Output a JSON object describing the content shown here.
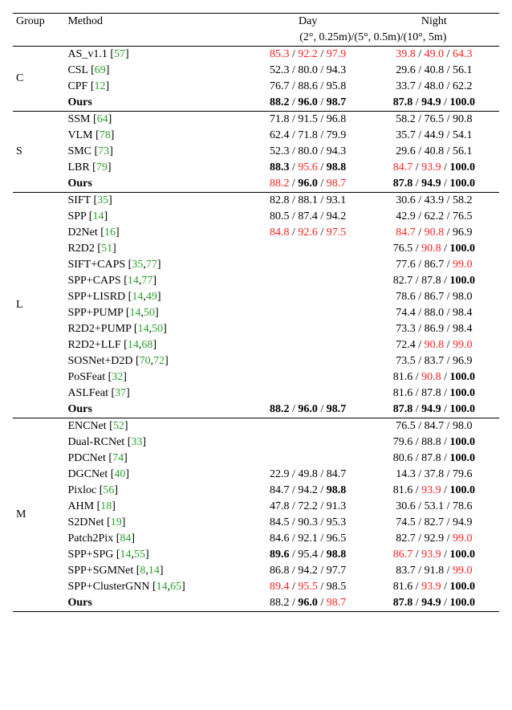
{
  "header": {
    "group": "Group",
    "method": "Method",
    "day": "Day",
    "night": "Night",
    "thresholds": "(2°, 0.25m)/(5°, 0.5m)/(10°, 5m)"
  },
  "chart_data": {
    "type": "table",
    "title": "",
    "columns": [
      "Group",
      "Method",
      "Day",
      "Night"
    ],
    "threshold_label": "(2°, 0.25m)/(5°, 0.5m)/(10°, 5m)"
  },
  "groups": [
    {
      "label": "C",
      "rows": [
        {
          "method": "AS_v1.1",
          "cites": [
            "57"
          ],
          "bold_method": false,
          "day": [
            {
              "v": "85.3",
              "red": true
            },
            {
              "v": "92.2",
              "red": true
            },
            {
              "v": "97.9",
              "red": true
            }
          ],
          "night": [
            {
              "v": "39.8",
              "red": true
            },
            {
              "v": "49.0",
              "red": true
            },
            {
              "v": "64.3",
              "red": true
            }
          ]
        },
        {
          "method": "CSL",
          "cites": [
            "69"
          ],
          "bold_method": false,
          "day": [
            {
              "v": "52.3"
            },
            {
              "v": "80.0"
            },
            {
              "v": "94.3"
            }
          ],
          "night": [
            {
              "v": "29.6"
            },
            {
              "v": "40.8"
            },
            {
              "v": "56.1"
            }
          ]
        },
        {
          "method": "CPF",
          "cites": [
            "12"
          ],
          "bold_method": false,
          "day": [
            {
              "v": "76.7"
            },
            {
              "v": "88.6"
            },
            {
              "v": "95.8"
            }
          ],
          "night": [
            {
              "v": "33.7"
            },
            {
              "v": "48.0"
            },
            {
              "v": "62.2"
            }
          ]
        },
        {
          "method": "Ours",
          "cites": [],
          "bold_method": true,
          "day": [
            {
              "v": "88.2",
              "bold": true
            },
            {
              "v": "96.0",
              "bold": true
            },
            {
              "v": "98.7",
              "bold": true
            }
          ],
          "night": [
            {
              "v": "87.8",
              "bold": true
            },
            {
              "v": "94.9",
              "bold": true
            },
            {
              "v": "100.0",
              "bold": true
            }
          ]
        }
      ]
    },
    {
      "label": "S",
      "rows": [
        {
          "method": "SSM",
          "cites": [
            "64"
          ],
          "day": [
            {
              "v": "71.8"
            },
            {
              "v": "91.5"
            },
            {
              "v": "96.8"
            }
          ],
          "night": [
            {
              "v": "58.2"
            },
            {
              "v": "76.5"
            },
            {
              "v": "90.8"
            }
          ]
        },
        {
          "method": "VLM",
          "cites": [
            "78"
          ],
          "day": [
            {
              "v": "62.4"
            },
            {
              "v": "71.8"
            },
            {
              "v": "79.9"
            }
          ],
          "night": [
            {
              "v": "35.7"
            },
            {
              "v": "44.9"
            },
            {
              "v": "54.1"
            }
          ]
        },
        {
          "method": "SMC",
          "cites": [
            "73"
          ],
          "day": [
            {
              "v": "52.3"
            },
            {
              "v": "80.0"
            },
            {
              "v": "94.3"
            }
          ],
          "night": [
            {
              "v": "29.6"
            },
            {
              "v": "40.8"
            },
            {
              "v": "56.1"
            }
          ]
        },
        {
          "method": "LBR",
          "cites": [
            "79"
          ],
          "day": [
            {
              "v": "88.3",
              "bold": true
            },
            {
              "v": "95.6",
              "red": true
            },
            {
              "v": "98.8",
              "bold": true
            }
          ],
          "night": [
            {
              "v": "84.7",
              "red": true
            },
            {
              "v": "93.9",
              "red": true
            },
            {
              "v": "100.0",
              "bold": true
            }
          ]
        },
        {
          "method": "Ours",
          "cites": [],
          "bold_method": true,
          "day": [
            {
              "v": "88.2",
              "red": true
            },
            {
              "v": "96.0",
              "bold": true
            },
            {
              "v": "98.7",
              "red": true
            }
          ],
          "night": [
            {
              "v": "87.8",
              "bold": true
            },
            {
              "v": "94.9",
              "bold": true
            },
            {
              "v": "100.0",
              "bold": true
            }
          ]
        }
      ]
    },
    {
      "label": "L",
      "rows": [
        {
          "method": "SIFT ",
          "cites": [
            "35"
          ],
          "day": [
            {
              "v": "82.8"
            },
            {
              "v": "88.1"
            },
            {
              "v": "93.1"
            }
          ],
          "night": [
            {
              "v": "30.6"
            },
            {
              "v": "43.9"
            },
            {
              "v": "58.2"
            }
          ]
        },
        {
          "method": "SPP",
          "cites": [
            "14"
          ],
          "day": [
            {
              "v": "80.5"
            },
            {
              "v": "87.4"
            },
            {
              "v": "94.2"
            }
          ],
          "night": [
            {
              "v": "42.9"
            },
            {
              "v": "62.2"
            },
            {
              "v": "76.5"
            }
          ]
        },
        {
          "method": "D2Net",
          "cites": [
            "16"
          ],
          "day": [
            {
              "v": "84.8",
              "red": true
            },
            {
              "v": "92.6",
              "red": true
            },
            {
              "v": "97.5",
              "red": true
            }
          ],
          "night": [
            {
              "v": "84.7",
              "red": true
            },
            {
              "v": "90.8",
              "red": true
            },
            {
              "v": "96.9"
            }
          ]
        },
        {
          "method": "R2D2",
          "cites": [
            "51"
          ],
          "day": [],
          "night": [
            {
              "v": "76.5"
            },
            {
              "v": "90.8",
              "red": true
            },
            {
              "v": "100.0",
              "bold": true
            }
          ]
        },
        {
          "method": "SIFT+CAPS",
          "cites": [
            "35",
            "77"
          ],
          "day": [],
          "night": [
            {
              "v": "77.6"
            },
            {
              "v": "86.7"
            },
            {
              "v": "99.0",
              "red": true
            }
          ]
        },
        {
          "method": "SPP+CAPS",
          "cites": [
            "14",
            "77"
          ],
          "day": [],
          "night": [
            {
              "v": "82.7"
            },
            {
              "v": "87.8"
            },
            {
              "v": "100.0",
              "bold": true
            }
          ]
        },
        {
          "method": "SPP+LISRD",
          "cites": [
            "14",
            "49"
          ],
          "day": [],
          "night": [
            {
              "v": "78.6"
            },
            {
              "v": "86.7"
            },
            {
              "v": "98.0"
            }
          ]
        },
        {
          "method": "SPP+PUMP",
          "cites": [
            "14",
            "50"
          ],
          "day": [],
          "night": [
            {
              "v": "74.4"
            },
            {
              "v": "88.0"
            },
            {
              "v": "98.4"
            }
          ]
        },
        {
          "method": "R2D2+PUMP",
          "cites": [
            "14",
            "50"
          ],
          "day": [],
          "night": [
            {
              "v": "73.3"
            },
            {
              "v": "86.9"
            },
            {
              "v": "98.4"
            }
          ]
        },
        {
          "method": "R2D2+LLF",
          "cites": [
            "14",
            "68"
          ],
          "day": [],
          "night": [
            {
              "v": "72.4"
            },
            {
              "v": "90.8",
              "red": true
            },
            {
              "v": "99.0",
              "red": true
            }
          ]
        },
        {
          "method": "SOSNet+D2D",
          "cites": [
            "70",
            "72"
          ],
          "day": [],
          "night": [
            {
              "v": "73.5"
            },
            {
              "v": "83.7"
            },
            {
              "v": "96.9"
            }
          ]
        },
        {
          "method": "PoSFeat",
          "cites": [
            "32"
          ],
          "day": [],
          "night": [
            {
              "v": "81.6"
            },
            {
              "v": "90.8",
              "red": true
            },
            {
              "v": "100.0",
              "bold": true
            }
          ]
        },
        {
          "method": "ASLFeat",
          "cites": [
            "37"
          ],
          "day": [],
          "night": [
            {
              "v": "81.6"
            },
            {
              "v": "87.8"
            },
            {
              "v": "100.0",
              "bold": true
            }
          ]
        },
        {
          "method": "Ours",
          "cites": [],
          "bold_method": true,
          "day": [
            {
              "v": "88.2",
              "bold": true
            },
            {
              "v": "96.0",
              "bold": true
            },
            {
              "v": "98.7",
              "bold": true
            }
          ],
          "night": [
            {
              "v": "87.8",
              "bold": true
            },
            {
              "v": "94.9",
              "bold": true
            },
            {
              "v": "100.0",
              "bold": true
            }
          ]
        }
      ]
    },
    {
      "label": "M",
      "rows": [
        {
          "method": "ENCNet",
          "cites": [
            "52"
          ],
          "day": [],
          "night": [
            {
              "v": "76.5"
            },
            {
              "v": "84.7"
            },
            {
              "v": "98.0"
            }
          ]
        },
        {
          "method": "Dual-RCNet",
          "cites": [
            "33"
          ],
          "day": [],
          "night": [
            {
              "v": "79.6"
            },
            {
              "v": "88.8"
            },
            {
              "v": "100.0",
              "bold": true
            }
          ]
        },
        {
          "method": "PDCNet",
          "cites": [
            "74"
          ],
          "day": [],
          "night": [
            {
              "v": "80.6"
            },
            {
              "v": "87.8"
            },
            {
              "v": "100.0",
              "bold": true
            }
          ]
        },
        {
          "method": "DGCNet",
          "cites": [
            "40"
          ],
          "day": [
            {
              "v": "22.9"
            },
            {
              "v": "49.8"
            },
            {
              "v": "84.7"
            }
          ],
          "night": [
            {
              "v": "14.3"
            },
            {
              "v": "37.8"
            },
            {
              "v": "79.6"
            }
          ]
        },
        {
          "method": "Pixloc",
          "cites": [
            "56"
          ],
          "day": [
            {
              "v": "84.7"
            },
            {
              "v": "94.2"
            },
            {
              "v": "98.8",
              "bold": true
            }
          ],
          "night": [
            {
              "v": "81.6"
            },
            {
              "v": "93.9",
              "red": true
            },
            {
              "v": "100.0",
              "bold": true
            }
          ]
        },
        {
          "method": "AHM",
          "cites": [
            "18"
          ],
          "day": [
            {
              "v": "47.8"
            },
            {
              "v": "72.2"
            },
            {
              "v": "91.3"
            }
          ],
          "night": [
            {
              "v": "30.6"
            },
            {
              "v": "53.1"
            },
            {
              "v": "78.6"
            }
          ]
        },
        {
          "method": "S2DNet",
          "cites": [
            "19"
          ],
          "day": [
            {
              "v": "84.5"
            },
            {
              "v": "90.3"
            },
            {
              "v": "95.3"
            }
          ],
          "night": [
            {
              "v": "74.5"
            },
            {
              "v": "82.7"
            },
            {
              "v": "94.9"
            }
          ]
        },
        {
          "method": "Patch2Pix",
          "cites": [
            "84"
          ],
          "day": [
            {
              "v": "84.6"
            },
            {
              "v": "92.1"
            },
            {
              "v": "96.5"
            }
          ],
          "night": [
            {
              "v": "82.7"
            },
            {
              "v": "92.9"
            },
            {
              "v": "99.0",
              "red": true
            }
          ]
        },
        {
          "method": "SPP+SPG",
          "cites": [
            "14",
            "55"
          ],
          "day": [
            {
              "v": "89.6",
              "bold": true
            },
            {
              "v": "95.4"
            },
            {
              "v": "98.8",
              "bold": true
            }
          ],
          "night": [
            {
              "v": "86.7",
              "red": true
            },
            {
              "v": "93.9",
              "red": true
            },
            {
              "v": "100.0",
              "bold": true
            }
          ]
        },
        {
          "method": "SPP+SGMNet",
          "cites": [
            "8",
            "14"
          ],
          "day": [
            {
              "v": "86.8"
            },
            {
              "v": "94.2"
            },
            {
              "v": "97.7"
            }
          ],
          "night": [
            {
              "v": "83.7"
            },
            {
              "v": "91.8"
            },
            {
              "v": "99.0",
              "red": true
            }
          ]
        },
        {
          "method": "SPP+ClusterGNN",
          "cites": [
            "14",
            "65"
          ],
          "day": [
            {
              "v": "89.4",
              "red": true
            },
            {
              "v": "95.5",
              "red": true
            },
            {
              "v": "98.5"
            }
          ],
          "night": [
            {
              "v": "81.6"
            },
            {
              "v": "93.9",
              "red": true
            },
            {
              "v": "100.0",
              "bold": true
            }
          ]
        },
        {
          "method": "Ours",
          "cites": [],
          "bold_method": true,
          "day": [
            {
              "v": "88.2"
            },
            {
              "v": "96.0",
              "bold": true
            },
            {
              "v": "98.7",
              "red": true
            }
          ],
          "night": [
            {
              "v": "87.8",
              "bold": true
            },
            {
              "v": "94.9",
              "bold": true
            },
            {
              "v": "100.0",
              "bold": true
            }
          ]
        }
      ]
    }
  ]
}
